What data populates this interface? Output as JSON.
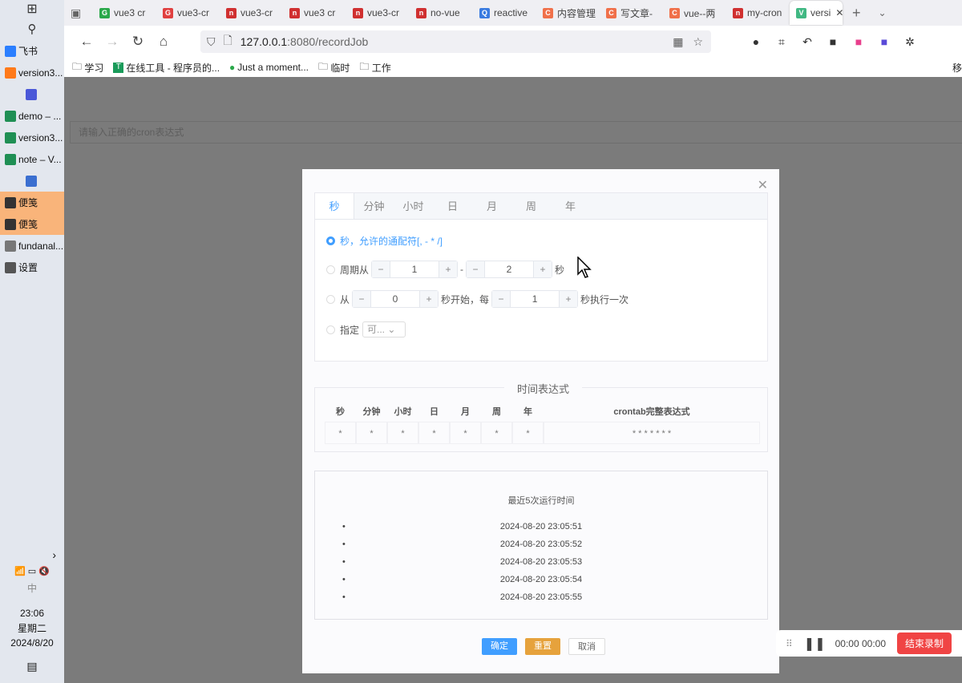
{
  "taskbar": {
    "items": [
      {
        "label": "飞书",
        "color": "#2b7fff"
      },
      {
        "label": "version3...",
        "color": "#ff7a1a"
      },
      {
        "label": "",
        "color": "#4a58d8"
      },
      {
        "label": "demo – ...",
        "color": "#1f8f54"
      },
      {
        "label": "version3...",
        "color": "#1f8f54"
      },
      {
        "label": "note – V...",
        "color": "#1f8f54"
      },
      {
        "label": "",
        "color": "#3b6fd0"
      },
      {
        "label": "便笺",
        "color": "#333"
      },
      {
        "label": "便笺",
        "color": "#333"
      },
      {
        "label": "fundanal...",
        "color": "#777"
      },
      {
        "label": "设置",
        "color": "#555"
      }
    ],
    "ime": "中",
    "time": "23:06",
    "weekday": "星期二",
    "date": "2024/8/20"
  },
  "browser": {
    "tabs": [
      {
        "label": "vue3 cr",
        "color": "#2aa84a",
        "glyph": "G"
      },
      {
        "label": "vue3-cr",
        "color": "#e04040",
        "glyph": "G"
      },
      {
        "label": "vue3-cr",
        "color": "#d03030",
        "glyph": "n"
      },
      {
        "label": "vue3 cr",
        "color": "#d03030",
        "glyph": "n"
      },
      {
        "label": "vue3-cr",
        "color": "#d03030",
        "glyph": "n"
      },
      {
        "label": "no-vue",
        "color": "#d03030",
        "glyph": "n"
      },
      {
        "label": "reactive",
        "color": "#3a7be0",
        "glyph": "Q"
      },
      {
        "label": "内容管理",
        "color": "#f0704a",
        "glyph": "C"
      },
      {
        "label": "写文章-",
        "color": "#f0704a",
        "glyph": "C"
      },
      {
        "label": "vue--两",
        "color": "#f0704a",
        "glyph": "C"
      },
      {
        "label": "my-cron",
        "color": "#d03030",
        "glyph": "n"
      },
      {
        "label": "versi",
        "color": "#41b883",
        "glyph": "V",
        "active": true
      }
    ],
    "url_host": "127.0.0.1",
    "url_rest": ":8080/recordJob",
    "bookmarks": [
      "学习",
      "在线工具 - 程序员的...",
      "Just a moment...",
      "临时",
      "工作"
    ],
    "mobile_bookmark": "移"
  },
  "page": {
    "cron_placeholder": "请输入正确的cron表达式"
  },
  "dialog": {
    "tabs": [
      "秒",
      "分钟",
      "小时",
      "日",
      "月",
      "周",
      "年"
    ],
    "options": {
      "wildcard": "秒，允许的通配符[, - * /]",
      "cycle_from": "周期从",
      "cycle_from_value": "1",
      "cycle_dash": "-",
      "cycle_to_value": "2",
      "cycle_unit": "秒",
      "from": "从",
      "from_value": "0",
      "from_mid": "秒开始，每",
      "every_value": "1",
      "every_suffix": "秒执行一次",
      "specify": "指定",
      "specify_placeholder": "可..."
    },
    "expression": {
      "legend": "时间表达式",
      "headers": [
        "秒",
        "分钟",
        "小时",
        "日",
        "月",
        "周",
        "年"
      ],
      "values": [
        "*",
        "*",
        "*",
        "*",
        "*",
        "*",
        "*"
      ],
      "full_header": "crontab完整表达式",
      "full_value": "* * * * * * *"
    },
    "runs": {
      "title": "最近5次运行时间",
      "times": [
        "2024-08-20 23:05:51",
        "2024-08-20 23:05:52",
        "2024-08-20 23:05:53",
        "2024-08-20 23:05:54",
        "2024-08-20 23:05:55"
      ]
    },
    "buttons": {
      "ok": "确定",
      "reset": "重置",
      "cancel": "取消"
    }
  },
  "recorder": {
    "time": "00:00 00:00",
    "stop": "结束录制"
  }
}
